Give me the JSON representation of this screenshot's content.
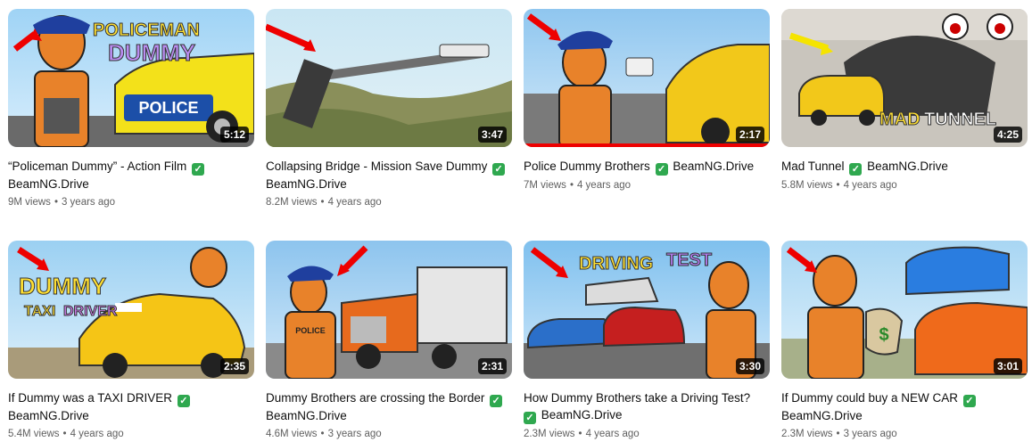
{
  "verified_icon": "✓",
  "videos": [
    {
      "thumb_text": [
        "POLICEMAN",
        "DUMMY"
      ],
      "sign_text": "POLICE",
      "duration": "5:12",
      "title": "“Policeman Dummy” - Action Film",
      "title_verified": true,
      "channel": "BeamNG.Drive",
      "channel_verified": false,
      "views": "9M views",
      "age": "3 years ago"
    },
    {
      "duration": "3:47",
      "title": "Collapsing Bridge - Mission Save Dummy",
      "title_verified": true,
      "channel": "BeamNG.Drive",
      "channel_verified": false,
      "views": "8.2M views",
      "age": "4 years ago"
    },
    {
      "duration": "2:17",
      "title": "Police Dummy Brothers",
      "title_verified": true,
      "channel": "BeamNG.Drive",
      "channel_verified": false,
      "inline_channel": true,
      "views": "7M views",
      "age": "4 years ago",
      "watched": true
    },
    {
      "thumb_text": [
        "MAD",
        "TUNNEL"
      ],
      "duration": "4:25",
      "title": "Mad Tunnel",
      "title_verified": true,
      "channel": "BeamNG.Drive",
      "channel_verified": false,
      "inline_channel": true,
      "views": "5.8M views",
      "age": "4 years ago"
    },
    {
      "thumb_text": [
        "DUMMY",
        "TAXI",
        "DRIVER"
      ],
      "duration": "2:35",
      "title": "If Dummy was a TAXI DRIVER",
      "title_verified": true,
      "channel": "BeamNG.Drive",
      "channel_verified": false,
      "views": "5.4M views",
      "age": "4 years ago"
    },
    {
      "sign_text": "POLICE",
      "duration": "2:31",
      "title": "Dummy Brothers are crossing the Border",
      "title_verified": true,
      "channel": "BeamNG.Drive",
      "channel_verified": false,
      "views": "4.6M views",
      "age": "3 years ago"
    },
    {
      "thumb_text": [
        "DRIVING",
        "TEST"
      ],
      "duration": "3:30",
      "title": "How Dummy Brothers take a Driving Test?",
      "title_verified": false,
      "channel": "BeamNG.Drive",
      "channel_verified": true,
      "views": "2.3M views",
      "age": "4 years ago"
    },
    {
      "sign_text": "$",
      "duration": "3:01",
      "title": "If Dummy could buy a NEW CAR",
      "title_verified": true,
      "channel": "BeamNG.Drive",
      "channel_verified": false,
      "views": "2.3M views",
      "age": "3 years ago"
    }
  ]
}
